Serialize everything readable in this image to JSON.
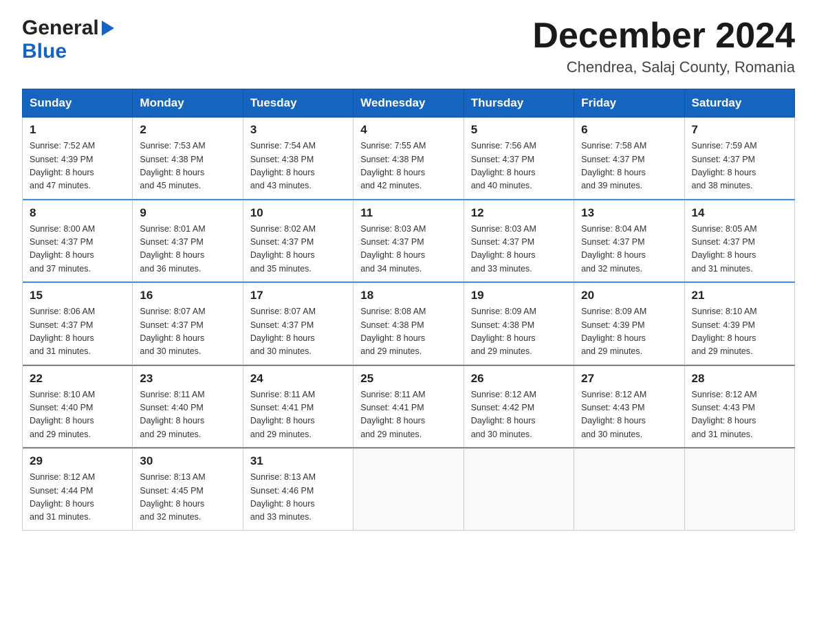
{
  "logo": {
    "line1": "General",
    "line2": "Blue"
  },
  "header": {
    "title": "December 2024",
    "subtitle": "Chendrea, Salaj County, Romania"
  },
  "weekdays": [
    "Sunday",
    "Monday",
    "Tuesday",
    "Wednesday",
    "Thursday",
    "Friday",
    "Saturday"
  ],
  "weeks": [
    [
      {
        "day": "1",
        "sunrise": "7:52 AM",
        "sunset": "4:39 PM",
        "daylight": "8 hours and 47 minutes."
      },
      {
        "day": "2",
        "sunrise": "7:53 AM",
        "sunset": "4:38 PM",
        "daylight": "8 hours and 45 minutes."
      },
      {
        "day": "3",
        "sunrise": "7:54 AM",
        "sunset": "4:38 PM",
        "daylight": "8 hours and 43 minutes."
      },
      {
        "day": "4",
        "sunrise": "7:55 AM",
        "sunset": "4:38 PM",
        "daylight": "8 hours and 42 minutes."
      },
      {
        "day": "5",
        "sunrise": "7:56 AM",
        "sunset": "4:37 PM",
        "daylight": "8 hours and 40 minutes."
      },
      {
        "day": "6",
        "sunrise": "7:58 AM",
        "sunset": "4:37 PM",
        "daylight": "8 hours and 39 minutes."
      },
      {
        "day": "7",
        "sunrise": "7:59 AM",
        "sunset": "4:37 PM",
        "daylight": "8 hours and 38 minutes."
      }
    ],
    [
      {
        "day": "8",
        "sunrise": "8:00 AM",
        "sunset": "4:37 PM",
        "daylight": "8 hours and 37 minutes."
      },
      {
        "day": "9",
        "sunrise": "8:01 AM",
        "sunset": "4:37 PM",
        "daylight": "8 hours and 36 minutes."
      },
      {
        "day": "10",
        "sunrise": "8:02 AM",
        "sunset": "4:37 PM",
        "daylight": "8 hours and 35 minutes."
      },
      {
        "day": "11",
        "sunrise": "8:03 AM",
        "sunset": "4:37 PM",
        "daylight": "8 hours and 34 minutes."
      },
      {
        "day": "12",
        "sunrise": "8:03 AM",
        "sunset": "4:37 PM",
        "daylight": "8 hours and 33 minutes."
      },
      {
        "day": "13",
        "sunrise": "8:04 AM",
        "sunset": "4:37 PM",
        "daylight": "8 hours and 32 minutes."
      },
      {
        "day": "14",
        "sunrise": "8:05 AM",
        "sunset": "4:37 PM",
        "daylight": "8 hours and 31 minutes."
      }
    ],
    [
      {
        "day": "15",
        "sunrise": "8:06 AM",
        "sunset": "4:37 PM",
        "daylight": "8 hours and 31 minutes."
      },
      {
        "day": "16",
        "sunrise": "8:07 AM",
        "sunset": "4:37 PM",
        "daylight": "8 hours and 30 minutes."
      },
      {
        "day": "17",
        "sunrise": "8:07 AM",
        "sunset": "4:37 PM",
        "daylight": "8 hours and 30 minutes."
      },
      {
        "day": "18",
        "sunrise": "8:08 AM",
        "sunset": "4:38 PM",
        "daylight": "8 hours and 29 minutes."
      },
      {
        "day": "19",
        "sunrise": "8:09 AM",
        "sunset": "4:38 PM",
        "daylight": "8 hours and 29 minutes."
      },
      {
        "day": "20",
        "sunrise": "8:09 AM",
        "sunset": "4:39 PM",
        "daylight": "8 hours and 29 minutes."
      },
      {
        "day": "21",
        "sunrise": "8:10 AM",
        "sunset": "4:39 PM",
        "daylight": "8 hours and 29 minutes."
      }
    ],
    [
      {
        "day": "22",
        "sunrise": "8:10 AM",
        "sunset": "4:40 PM",
        "daylight": "8 hours and 29 minutes."
      },
      {
        "day": "23",
        "sunrise": "8:11 AM",
        "sunset": "4:40 PM",
        "daylight": "8 hours and 29 minutes."
      },
      {
        "day": "24",
        "sunrise": "8:11 AM",
        "sunset": "4:41 PM",
        "daylight": "8 hours and 29 minutes."
      },
      {
        "day": "25",
        "sunrise": "8:11 AM",
        "sunset": "4:41 PM",
        "daylight": "8 hours and 29 minutes."
      },
      {
        "day": "26",
        "sunrise": "8:12 AM",
        "sunset": "4:42 PM",
        "daylight": "8 hours and 30 minutes."
      },
      {
        "day": "27",
        "sunrise": "8:12 AM",
        "sunset": "4:43 PM",
        "daylight": "8 hours and 30 minutes."
      },
      {
        "day": "28",
        "sunrise": "8:12 AM",
        "sunset": "4:43 PM",
        "daylight": "8 hours and 31 minutes."
      }
    ],
    [
      {
        "day": "29",
        "sunrise": "8:12 AM",
        "sunset": "4:44 PM",
        "daylight": "8 hours and 31 minutes."
      },
      {
        "day": "30",
        "sunrise": "8:13 AM",
        "sunset": "4:45 PM",
        "daylight": "8 hours and 32 minutes."
      },
      {
        "day": "31",
        "sunrise": "8:13 AM",
        "sunset": "4:46 PM",
        "daylight": "8 hours and 33 minutes."
      },
      null,
      null,
      null,
      null
    ]
  ],
  "labels": {
    "sunrise": "Sunrise:",
    "sunset": "Sunset:",
    "daylight": "Daylight:"
  }
}
